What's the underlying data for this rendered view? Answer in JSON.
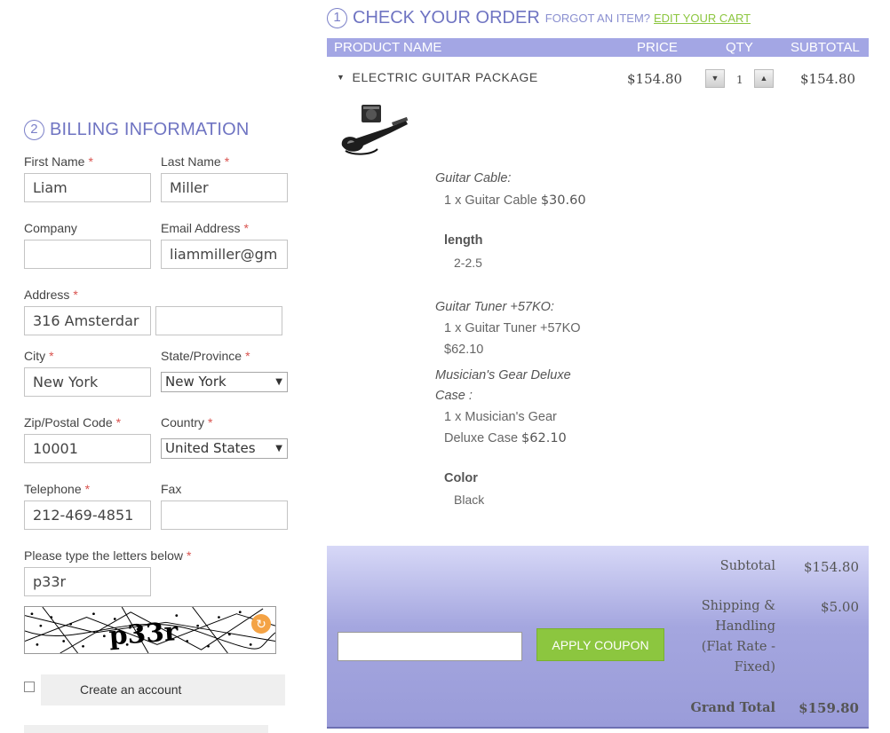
{
  "billing": {
    "step": "2",
    "title": "BILLING INFORMATION",
    "required_mark": "*",
    "first_name_label": "First Name",
    "first_name_value": "Liam",
    "last_name_label": "Last Name",
    "last_name_value": "Miller",
    "company_label": "Company",
    "company_value": "",
    "email_label": "Email Address",
    "email_value": "liammiller@gm",
    "address_label": "Address",
    "address_value": "316 Amsterdar",
    "address2_value": "",
    "city_label": "City",
    "city_value": "New York",
    "state_label": "State/Province",
    "state_value": "New York",
    "zip_label": "Zip/Postal Code",
    "zip_value": "10001",
    "country_label": "Country",
    "country_value": "United States",
    "telephone_label": "Telephone",
    "telephone_value": "212-469-4851",
    "fax_label": "Fax",
    "fax_value": "",
    "captcha_label": "Please type the letters below",
    "captcha_value": "p33r",
    "create_account_label": "Create an account"
  },
  "order": {
    "step": "1",
    "title": "CHECK YOUR ORDER",
    "forgot_text": "FORGOT AN ITEM?",
    "edit_cart_link": "EDIT YOUR CART",
    "headers": {
      "product": "PRODUCT NAME",
      "price": "PRICE",
      "qty": "QTY",
      "subtotal": "SUBTOTAL"
    },
    "item": {
      "name": "ELECTRIC GUITAR PACKAGE",
      "price": "$154.80",
      "qty": "1",
      "subtotal": "$154.80",
      "options": [
        {
          "title": "Guitar Cable:",
          "line1": "1 x Guitar Cable ",
          "price": "$30.60"
        },
        {
          "attr": "length",
          "value": "2-2.5"
        },
        {
          "title": "Guitar Tuner +57KO:",
          "line1": "1 x Guitar Tuner +57KO",
          "price": "$62.10"
        },
        {
          "title_line1": "Musician's Gear Deluxe",
          "title_line2": "Case :",
          "line1": "1 x Musician's Gear",
          "line2": "Deluxe Case ",
          "price": "$62.10"
        },
        {
          "attr": "Color",
          "value": "Black"
        }
      ]
    }
  },
  "totals": {
    "coupon_value": "",
    "coupon_button": "APPLY COUPON",
    "subtotal_label": "Subtotal",
    "subtotal_value": "$154.80",
    "shipping_label_lines": [
      "Shipping &",
      "Handling",
      "(Flat Rate -",
      "Fixed)"
    ],
    "shipping_value": "$5.00",
    "grand_total_label": "Grand Total",
    "grand_total_value": "$159.80"
  },
  "colors": {
    "accent_purple": "#6f74c2",
    "header_bg": "#a3a6e4",
    "green": "#8cc63f",
    "required": "#d9534f"
  }
}
